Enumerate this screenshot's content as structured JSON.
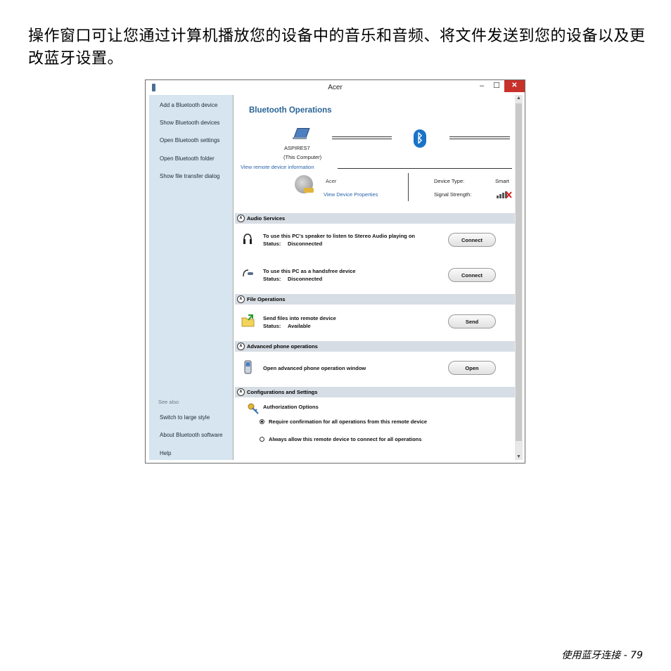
{
  "intro": "操作窗口可让您通过计算机播放您的设备中的音乐和音频、将文件发送到您的设备以及更改蓝牙设置。",
  "window": {
    "title": "Acer",
    "controls": {
      "minimize": "–",
      "maximize": "☐",
      "close": "✕"
    }
  },
  "sidebar": {
    "links": [
      "Add a Bluetooth device",
      "Show Bluetooth devices",
      "Open Bluetooth settings",
      "Open Bluetooth folder",
      "Show file transfer dialog"
    ],
    "see_also": "See also",
    "bottom_links": [
      "Switch to large style",
      "About Bluetooth software",
      "Help"
    ]
  },
  "main": {
    "heading": "Bluetooth Operations",
    "computer_name": "ASPIRES7",
    "computer_sub": "(This Computer)",
    "view_remote": "View remote device information",
    "device_name": "Acer",
    "device_props": "View Device Properties",
    "device_type_label": "Device Type:",
    "device_type_value": "Smart",
    "signal_label": "Signal Strength:"
  },
  "sections": {
    "audio": "Audio Services",
    "file": "File Operations",
    "phone": "Advanced phone operations",
    "config": "Configurations and Settings"
  },
  "rows": {
    "stereo_desc": "To use this PC's speaker to listen to Stereo Audio playing on",
    "stereo_status_label": "Status:",
    "stereo_status": "Disconnected",
    "handsfree_desc": "To use this PC as a handsfree device",
    "handsfree_status_label": "Status:",
    "handsfree_status": "Disconnected",
    "send_desc": "Send files into remote device",
    "send_status_label": "Status:",
    "send_status": "Available",
    "phone_desc": "Open advanced phone operation window",
    "auth_title": "Authorization Options",
    "radio_confirm": "Require confirmation for all operations from this remote device",
    "radio_always": "Always allow this remote device to connect for all operations"
  },
  "buttons": {
    "connect1": "Connect",
    "connect2": "Connect",
    "send": "Send",
    "open": "Open"
  },
  "footer": "使用蓝牙连接 -  79",
  "colors": {
    "link": "#2a64ad",
    "heading": "#2a6496",
    "sidebar": "#d6e5ef",
    "close": "#c8302a"
  }
}
